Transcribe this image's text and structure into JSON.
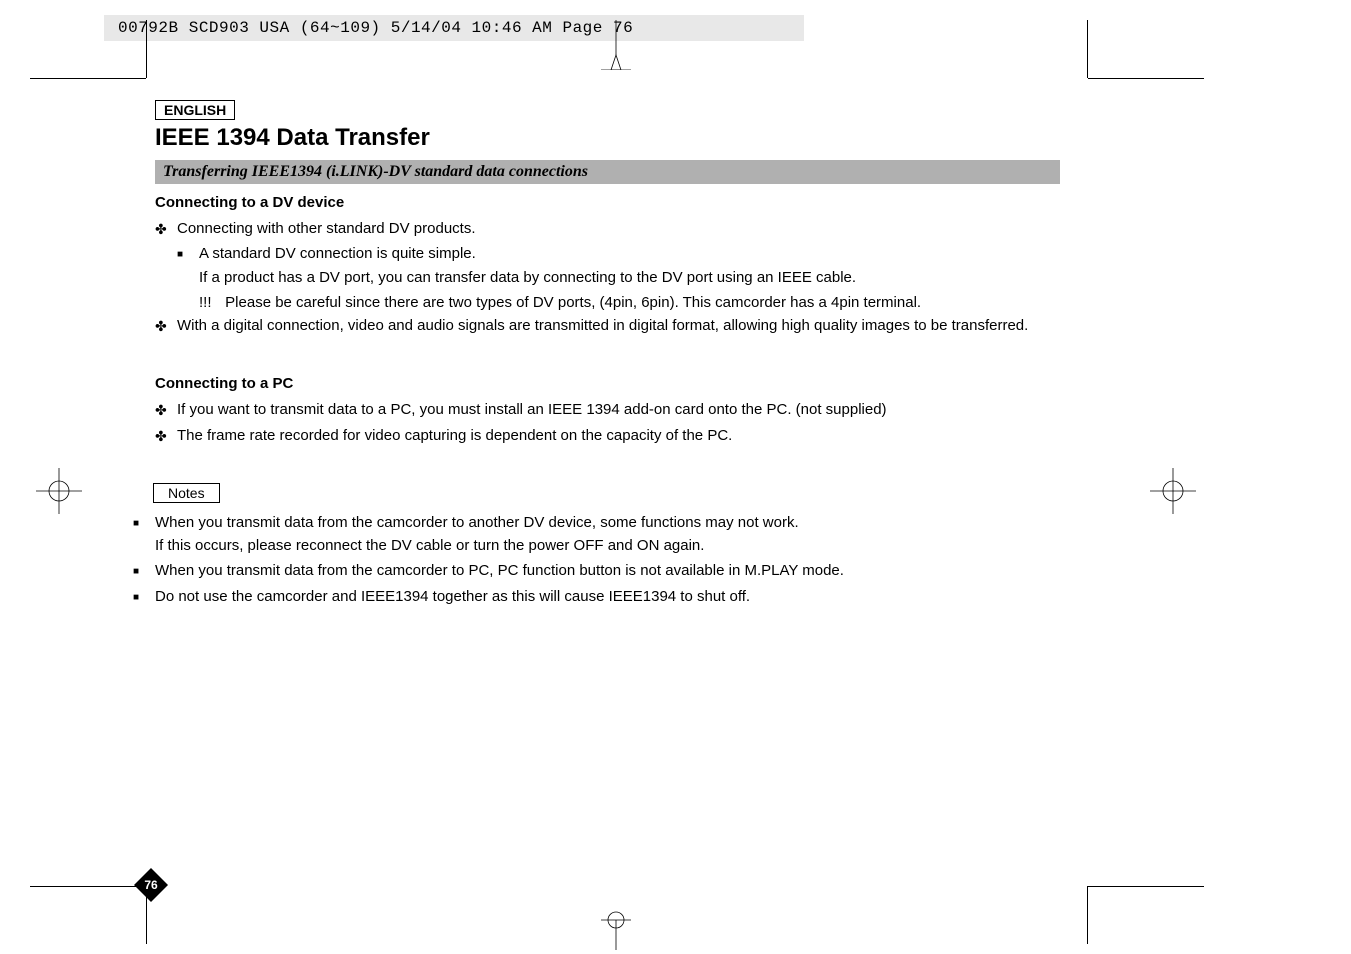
{
  "header_strip": "00792B SCD903 USA (64~109)  5/14/04 10:46 AM  Page 76",
  "lang": "ENGLISH",
  "title": "IEEE 1394 Data Transfer",
  "section_bar": "Transferring IEEE1394 (i.LINK)-DV standard data connections",
  "dv": {
    "heading": "Connecting to a DV device",
    "b1": "Connecting with other standard DV products.",
    "b1a": "A standard DV connection is quite simple.",
    "b1a_line2": "If a product has a DV port, you can transfer data by connecting to the DV port using an IEEE cable.",
    "b1a_excl": "!!!",
    "b1a_warn": "Please be careful since there are two types of DV ports, (4pin, 6pin). This camcorder has a 4pin terminal.",
    "b2": "With a digital connection, video and audio signals are transmitted in digital format, allowing high quality images to be transferred."
  },
  "pc": {
    "heading": "Connecting to a PC",
    "b1": "If you want to transmit data to a PC, you must install an IEEE 1394 add-on card onto the PC. (not supplied)",
    "b2": "The frame rate recorded for video capturing is dependent on the capacity of the PC."
  },
  "notes": {
    "label": "Notes",
    "n1": "When you transmit data from the camcorder to another DV device, some functions may not work.",
    "n1_line2": "If this occurs, please reconnect the DV cable or turn the power OFF and ON again.",
    "n2": "When you transmit data from the camcorder to PC, PC function button is not available in M.PLAY mode.",
    "n3": "Do not use the camcorder and IEEE1394 together as this will cause IEEE1394 to shut off."
  },
  "page_number": "76"
}
